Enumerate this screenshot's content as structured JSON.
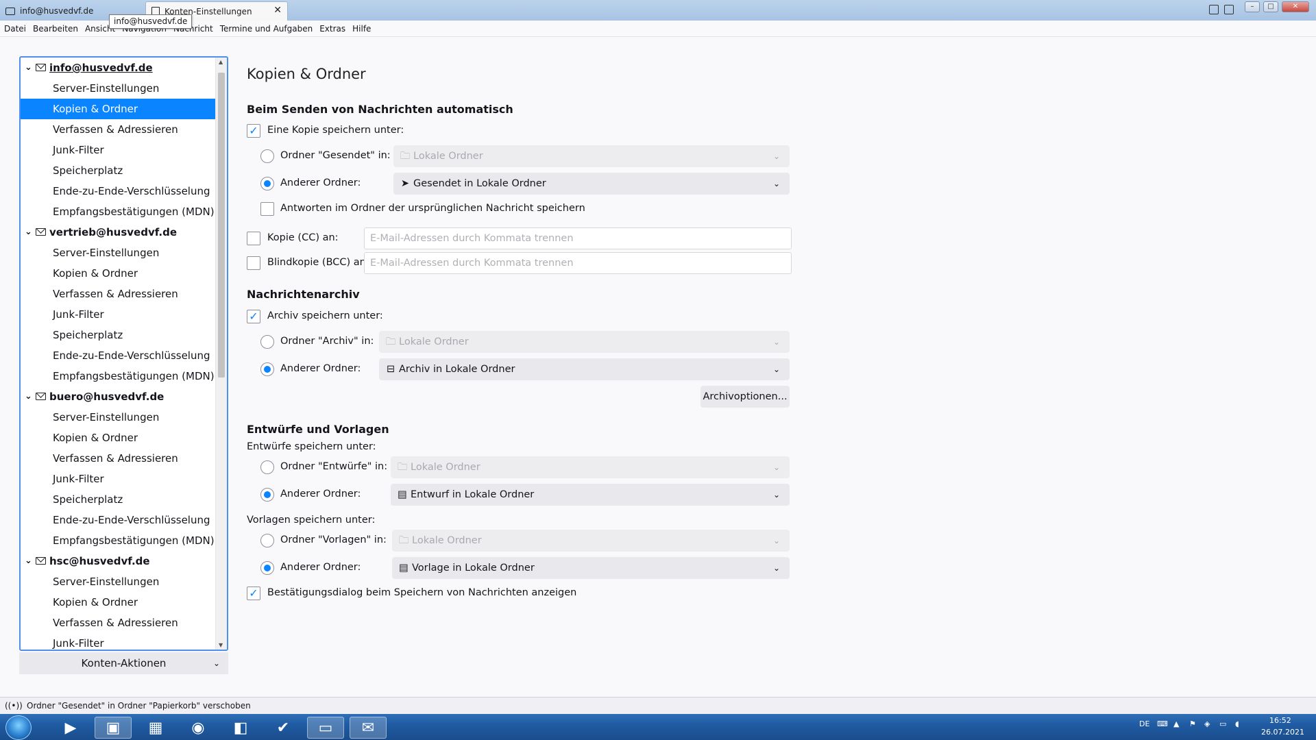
{
  "window": {
    "tabs": [
      {
        "label": "info@husvedvf.de"
      },
      {
        "label": "Konten-Einstellungen"
      }
    ],
    "tooltip": "info@husvedvf.de",
    "close_glyph": "✕"
  },
  "menu": [
    "Datei",
    "Bearbeiten",
    "Ansicht",
    "Navigation",
    "Nachricht",
    "Termine und Aufgaben",
    "Extras",
    "Hilfe"
  ],
  "sidebar": {
    "accounts": [
      {
        "name": "info@husvedvf.de",
        "items": [
          "Server-Einstellungen",
          "Kopien & Ordner",
          "Verfassen & Adressieren",
          "Junk-Filter",
          "Speicherplatz",
          "Ende-zu-Ende-Verschlüsselung",
          "Empfangsbestätigungen (MDN)"
        ]
      },
      {
        "name": "vertrieb@husvedvf.de",
        "items": [
          "Server-Einstellungen",
          "Kopien & Ordner",
          "Verfassen & Adressieren",
          "Junk-Filter",
          "Speicherplatz",
          "Ende-zu-Ende-Verschlüsselung",
          "Empfangsbestätigungen (MDN)"
        ]
      },
      {
        "name": "buero@husvedvf.de",
        "items": [
          "Server-Einstellungen",
          "Kopien & Ordner",
          "Verfassen & Adressieren",
          "Junk-Filter",
          "Speicherplatz",
          "Ende-zu-Ende-Verschlüsselung",
          "Empfangsbestätigungen (MDN)"
        ]
      },
      {
        "name": "hsc@husvedvf.de",
        "items": [
          "Server-Einstellungen",
          "Kopien & Ordner",
          "Verfassen & Adressieren",
          "Junk-Filter"
        ]
      }
    ],
    "selected": "info@husvedvf.de / Kopien & Ordner",
    "actions_label": "Konten-Aktionen"
  },
  "main": {
    "title": "Kopien & Ordner",
    "send": {
      "heading": "Beim Senden von Nachrichten automatisch",
      "save_copy_label": "Eine Kopie speichern unter:",
      "save_copy_checked": true,
      "sent_folder_label": "Ordner \"Gesendet\" in:",
      "sent_folder_value": "Lokale Ordner",
      "other_folder_label": "Anderer Ordner:",
      "other_folder_value": "Gesendet in Lokale Ordner",
      "other_folder_selected": true,
      "replies_label": "Antworten im Ordner der ursprünglichen Nachricht speichern",
      "replies_checked": false,
      "cc_label": "Kopie (CC) an:",
      "cc_placeholder": "E-Mail-Adressen durch Kommata trennen",
      "bcc_label": "Blindkopie (BCC) an:",
      "bcc_placeholder": "E-Mail-Adressen durch Kommata trennen"
    },
    "archive": {
      "heading": "Nachrichtenarchiv",
      "save_label": "Archiv speichern unter:",
      "save_checked": true,
      "archive_folder_label": "Ordner \"Archiv\" in:",
      "archive_folder_value": "Lokale Ordner",
      "other_folder_label": "Anderer Ordner:",
      "other_folder_value": "Archiv in Lokale Ordner",
      "options_button": "Archivoptionen..."
    },
    "drafts": {
      "heading": "Entwürfe und Vorlagen",
      "drafts_label": "Entwürfe speichern unter:",
      "drafts_folder_label": "Ordner \"Entwürfe\" in:",
      "drafts_folder_value": "Lokale Ordner",
      "drafts_other_label": "Anderer Ordner:",
      "drafts_other_value": "Entwurf in Lokale Ordner",
      "templates_label": "Vorlagen speichern unter:",
      "templates_folder_label": "Ordner \"Vorlagen\" in:",
      "templates_folder_value": "Lokale Ordner",
      "templates_other_label": "Anderer Ordner:",
      "templates_other_value": "Vorlage in Lokale Ordner",
      "confirm_label": "Bestätigungsdialog beim Speichern von Nachrichten anzeigen",
      "confirm_checked": true
    }
  },
  "status": {
    "text": "Ordner \"Gesendet\" in Ordner \"Papierkorb\" verschoben"
  },
  "taskbar": {
    "lang": "DE",
    "time": "16:52",
    "date": "26.07.2021"
  },
  "icons": {
    "check": "✓",
    "chevron": "⌄",
    "twisty": "⌄",
    "folder": "🗀"
  }
}
